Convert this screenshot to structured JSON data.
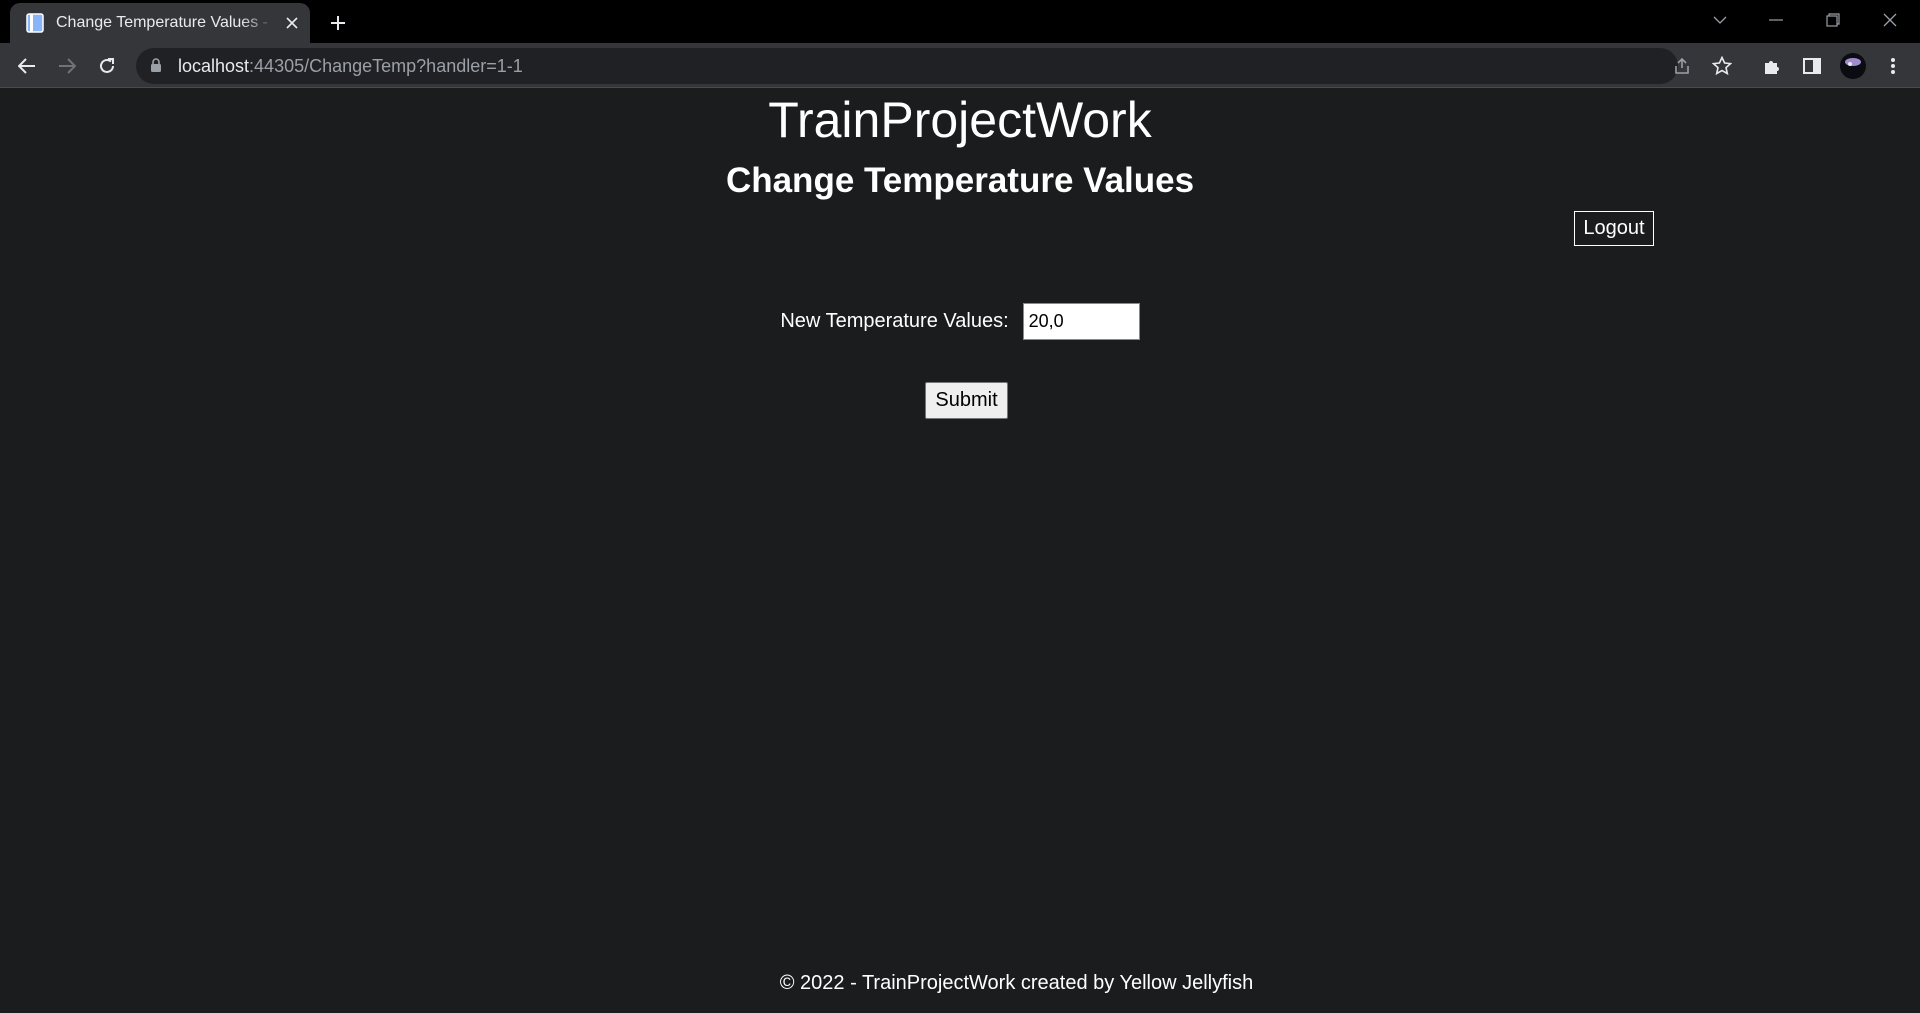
{
  "browser": {
    "tab_title": "Change Temperature Values - TrainProjectWork",
    "url_host": "localhost",
    "url_path": ":44305/ChangeTemp?handler=1-1"
  },
  "page": {
    "brand": "TrainProjectWork",
    "heading": "Change Temperature Values",
    "logout_label": "Logout",
    "form": {
      "label": "New Temperature Values:",
      "value": "20,0",
      "submit_label": "Submit"
    },
    "footer": "© 2022 - TrainProjectWork created by Yellow Jellyfish"
  }
}
